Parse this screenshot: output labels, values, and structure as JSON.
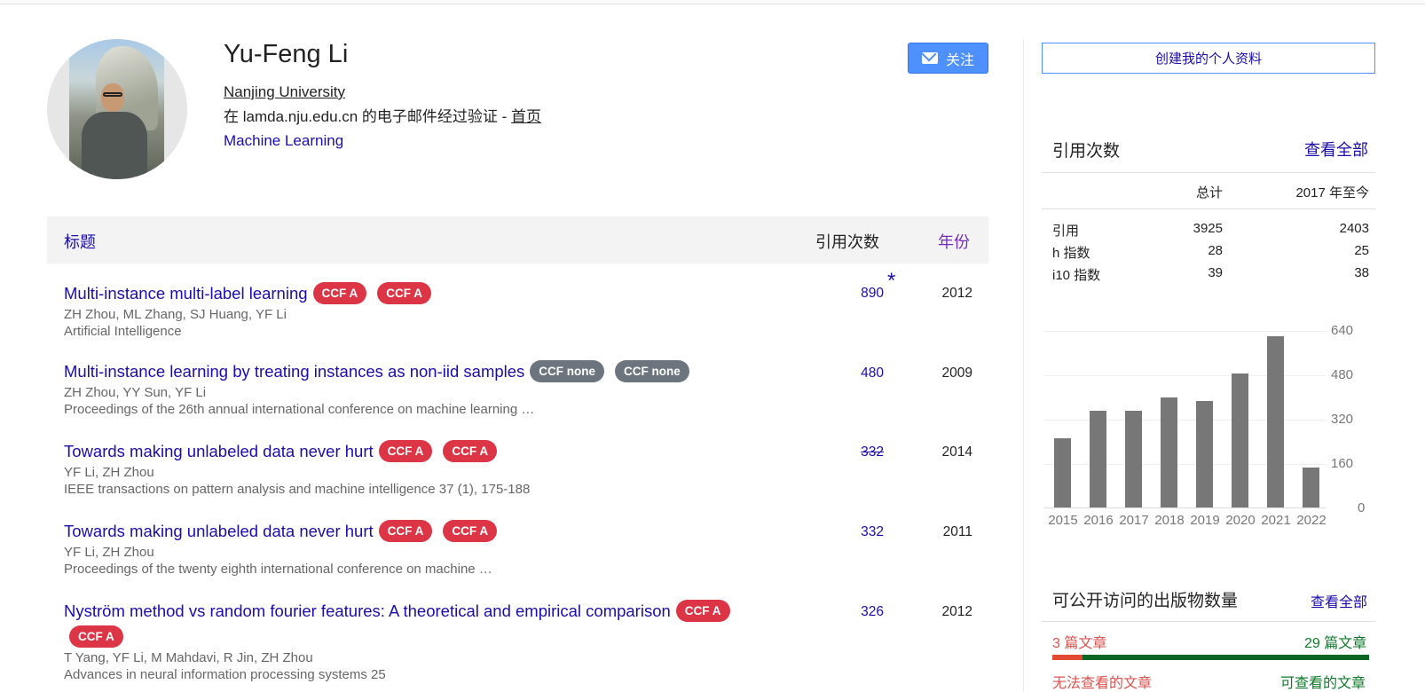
{
  "profile": {
    "name": "Yu-Feng Li",
    "affiliation": "Nanjing University",
    "verified_prefix": "在 lamda.nju.edu.cn 的电子邮件经过验证 - ",
    "homepage_label": "首页",
    "interest": "Machine Learning",
    "follow_label": "关注"
  },
  "table": {
    "col_title": "标题",
    "col_citations": "引用次数",
    "col_year": "年份",
    "rows": [
      {
        "title": "Multi-instance multi-label learning",
        "badges": [
          "CCF A",
          "CCF A"
        ],
        "authors": "ZH Zhou, ML Zhang, SJ Huang, YF Li",
        "venue": "Artificial Intelligence",
        "citations": "890",
        "year": "2012"
      },
      {
        "title": "Multi-instance learning by treating instances as non-iid samples",
        "badges": [
          "CCF none",
          "CCF none"
        ],
        "authors": "ZH Zhou, YY Sun, YF Li",
        "venue": "Proceedings of the 26th annual international conference on machine learning …",
        "citations": "480",
        "year": "2009"
      },
      {
        "title": "Towards making unlabeled data never hurt",
        "badges": [
          "CCF A",
          "CCF A"
        ],
        "authors": "YF Li, ZH Zhou",
        "venue": "IEEE transactions on pattern analysis and machine intelligence 37 (1), 175-188",
        "citations": "332",
        "year": "2014"
      },
      {
        "title": "Towards making unlabeled data never hurt",
        "badges": [
          "CCF A",
          "CCF A"
        ],
        "authors": "YF Li, ZH Zhou",
        "venue": "Proceedings of the twenty eighth international conference on machine …",
        "citations": "332",
        "year": "2011"
      },
      {
        "title": "Nyström method vs random fourier features: A theoretical and empirical comparison",
        "badges": [
          "CCF A",
          "CCF A"
        ],
        "authors": "T Yang, YF Li, M Mahdavi, R Jin, ZH Zhou",
        "venue": "Advances in neural information processing systems 25",
        "citations": "326",
        "year": "2012"
      }
    ],
    "star": "*"
  },
  "sidebar": {
    "create_profile": "创建我的个人资料",
    "cited_by": {
      "title": "引用次数",
      "view_all": "查看全部",
      "col_all": "总计",
      "col_since": "2017 年至今",
      "rows": [
        {
          "label": "引用",
          "all": "3925",
          "since": "2403"
        },
        {
          "label": "h 指数",
          "all": "28",
          "since": "25"
        },
        {
          "label": "i10 指数",
          "all": "39",
          "since": "38"
        }
      ]
    },
    "open_access": {
      "title": "可公开访问的出版物数量",
      "view_all": "查看全部",
      "unavailable_count": "3 篇文章",
      "available_count": "29 篇文章",
      "unavailable_label": "无法查看的文章",
      "available_label": "可查看的文章",
      "available_fraction": 0.906
    }
  },
  "chart_data": {
    "type": "bar",
    "categories": [
      "2015",
      "2016",
      "2017",
      "2018",
      "2019",
      "2020",
      "2021",
      "2022"
    ],
    "values": [
      250,
      350,
      350,
      400,
      385,
      485,
      620,
      145
    ],
    "yticks": [
      "640",
      "480",
      "320",
      "160",
      "0"
    ],
    "ylim": [
      0,
      640
    ],
    "grid": true
  }
}
